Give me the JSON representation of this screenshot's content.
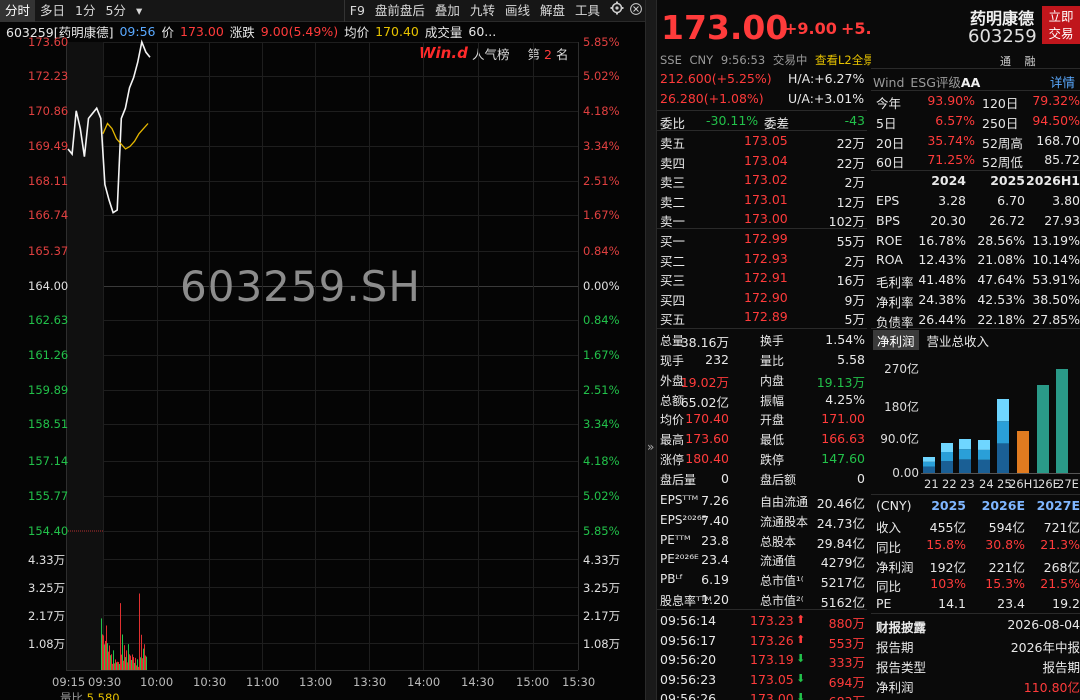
{
  "toolbar": {
    "items": [
      "分时",
      "多日",
      "1分",
      "5分",
      "▾",
      "F9",
      "盘前盘后",
      "叠加",
      "九转",
      "画线",
      "解盘",
      "工具"
    ],
    "gear_icon": "gear-icon",
    "close_icon": "close-icon"
  },
  "info": {
    "code": "603259[药明康德]",
    "time": "09:56",
    "price_label": "价",
    "price": "173.00",
    "change_label": "涨跌",
    "change": "9.00(5.49%)",
    "avg_label": "均价",
    "avg": "170.40",
    "vol_label": "成交量",
    "vol": "60..."
  },
  "chart": {
    "watermark": "603259.SH",
    "logo": "Win.d",
    "rank_label": "人气榜",
    "rank_prefix": "第",
    "rank_num": "2",
    "rank_suffix": "名",
    "left_prices": [
      "173.60",
      "172.23",
      "170.86",
      "169.49",
      "168.11",
      "166.74",
      "165.37",
      "164.00",
      "162.63",
      "161.26",
      "159.89",
      "158.51",
      "157.14",
      "155.77",
      "154.40"
    ],
    "right_pcts": [
      "5.85%",
      "5.02%",
      "4.18%",
      "3.34%",
      "2.51%",
      "1.67%",
      "0.84%",
      "0.00%",
      "0.84%",
      "1.67%",
      "2.51%",
      "3.34%",
      "4.18%",
      "5.02%",
      "5.85%"
    ],
    "vol_left": [
      "4.33万",
      "3.25万",
      "2.17万",
      "1.08万"
    ],
    "vol_right": [
      "4.33万",
      "3.25万",
      "2.17万",
      "1.08万"
    ],
    "x_labels": [
      "09:15",
      "09:30",
      "10:00",
      "10:30",
      "11:00",
      "13:00",
      "13:30",
      "14:00",
      "14:30",
      "15:00",
      "15:30"
    ],
    "bottom_label": "量比",
    "bottom_value": "5.580"
  },
  "header": {
    "price": "173.00",
    "change": "+9.00",
    "change_pct": "+5.49%",
    "name": "药明康德",
    "code": "603259",
    "trade_btn_line1": "立即",
    "trade_btn_line2": "交易",
    "exch": "SSE",
    "ccy": "CNY",
    "time": "9:56:53",
    "status": "交易中",
    "l2": "查看L2全景",
    "tong": "通",
    "rong": "融",
    "h_price": "212.600(+5.25%)",
    "h_ah": "H/A:+6.27%",
    "u_price": "26.280(+1.08%)",
    "u_ah": "U/A:+3.01%"
  },
  "orderbook": {
    "weibi_label": "委比",
    "weibi": "-30.11%",
    "weicha_label": "委差",
    "weicha": "-43",
    "asks": [
      {
        "label": "卖五",
        "price": "173.05",
        "vol": "22万"
      },
      {
        "label": "卖四",
        "price": "173.04",
        "vol": "22万"
      },
      {
        "label": "卖三",
        "price": "173.02",
        "vol": "2万"
      },
      {
        "label": "卖二",
        "price": "173.01",
        "vol": "12万"
      },
      {
        "label": "卖一",
        "price": "173.00",
        "vol": "102万"
      }
    ],
    "bids": [
      {
        "label": "买一",
        "price": "172.99",
        "vol": "55万"
      },
      {
        "label": "买二",
        "price": "172.93",
        "vol": "2万"
      },
      {
        "label": "买三",
        "price": "172.91",
        "vol": "16万"
      },
      {
        "label": "买四",
        "price": "172.90",
        "vol": "9万"
      },
      {
        "label": "买五",
        "price": "172.89",
        "vol": "5万"
      }
    ]
  },
  "stats": [
    {
      "l1": "总量",
      "v1": "38.16万",
      "c1": "white",
      "l2": "换手",
      "v2": "1.54%",
      "c2": "white"
    },
    {
      "l1": "现手",
      "v1": "232",
      "c1": "white",
      "l2": "量比",
      "v2": "5.58",
      "c2": "white"
    },
    {
      "l1": "外盘",
      "v1": "19.02万",
      "c1": "red",
      "l2": "内盘",
      "v2": "19.13万",
      "c2": "green"
    },
    {
      "l1": "总额",
      "v1": "65.02亿",
      "c1": "white",
      "l2": "振幅",
      "v2": "4.25%",
      "c2": "white"
    },
    {
      "l1": "均价",
      "v1": "170.40",
      "c1": "red",
      "l2": "开盘",
      "v2": "171.00",
      "c2": "red"
    },
    {
      "l1": "最高",
      "v1": "173.60",
      "c1": "red",
      "l2": "最低",
      "v2": "166.63",
      "c2": "red"
    },
    {
      "l1": "涨停",
      "v1": "180.40",
      "c1": "red",
      "l2": "跌停",
      "v2": "147.60",
      "c2": "green"
    },
    {
      "l1": "盘后量",
      "v1": "0",
      "c1": "white",
      "l2": "盘后额",
      "v2": "0",
      "c2": "white"
    },
    {
      "l1": "EPSᵀᵀᴹ",
      "v1": "7.26",
      "c1": "white",
      "l2": "自由流通",
      "v2": "20.46亿",
      "c2": "white"
    },
    {
      "l1": "EPS²⁰²⁶ᴱ",
      "v1": "7.40",
      "c1": "white",
      "l2": "流通股本",
      "v2": "24.73亿",
      "c2": "white"
    },
    {
      "l1": "PEᵀᵀᴹ",
      "v1": "23.8",
      "c1": "white",
      "l2": "总股本",
      "v2": "29.84亿",
      "c2": "white"
    },
    {
      "l1": "PE²⁰²⁶ᴱ",
      "v1": "23.4",
      "c1": "white",
      "l2": "流通值",
      "v2": "4279亿",
      "c2": "white"
    },
    {
      "l1": "PBᴸᶠ",
      "v1": "6.19",
      "c1": "white",
      "l2": "总市值¹⁽",
      "v2": "5217亿",
      "c2": "white"
    },
    {
      "l1": "股息率ᵀᵀᴹ",
      "v1": "1.20",
      "c1": "white",
      "l2": "总市值²⁽",
      "v2": "5162亿",
      "c2": "white"
    }
  ],
  "ticks": [
    {
      "time": "09:56:14",
      "price": "173.23",
      "dir": "up",
      "vol": "880万"
    },
    {
      "time": "09:56:17",
      "price": "173.26",
      "dir": "up",
      "vol": "553万"
    },
    {
      "time": "09:56:20",
      "price": "173.19",
      "dir": "down",
      "vol": "333万"
    },
    {
      "time": "09:56:23",
      "price": "173.05",
      "dir": "down",
      "vol": "694万"
    },
    {
      "time": "09:56:26",
      "price": "173.00",
      "dir": "down",
      "vol": "683万"
    }
  ],
  "right": {
    "tabs": [
      "Wind",
      "ESG评级",
      "AA"
    ],
    "detail": "详情",
    "perf": [
      {
        "l1": "今年",
        "v1": "93.90%",
        "l2": "120日",
        "v2": "79.32%"
      },
      {
        "l1": "5日",
        "v1": "6.57%",
        "l2": "250日",
        "v2": "94.50%"
      },
      {
        "l1": "20日",
        "v1": "35.74%",
        "l2": "52周高",
        "v2": "168.70"
      },
      {
        "l1": "60日",
        "v1": "71.25%",
        "l2": "52周低",
        "v2": "85.72"
      }
    ],
    "fin_head": [
      "2024",
      "2025",
      "2026H1"
    ],
    "fin": [
      {
        "l": "EPS",
        "a": "3.28",
        "b": "6.70",
        "c": "3.80"
      },
      {
        "l": "BPS",
        "a": "20.30",
        "b": "26.72",
        "c": "27.93"
      },
      {
        "l": "ROE",
        "a": "16.78%",
        "b": "28.56%",
        "c": "13.19%"
      },
      {
        "l": "ROA",
        "a": "12.43%",
        "b": "21.08%",
        "c": "10.14%"
      },
      {
        "l": "毛利率",
        "a": "41.48%",
        "b": "47.64%",
        "c": "53.91%"
      },
      {
        "l": "净利率",
        "a": "24.38%",
        "b": "42.53%",
        "c": "38.50%"
      },
      {
        "l": "负债率",
        "a": "26.44%",
        "b": "22.18%",
        "c": "27.85%"
      }
    ],
    "chart_tabs": [
      "净利润",
      "营业总收入"
    ],
    "chart_y": [
      "270亿",
      "180亿",
      "90.0亿",
      "0.00"
    ],
    "chart_x": [
      "21",
      "22",
      "23",
      "24",
      "25",
      "26H1",
      "26E",
      "27E"
    ],
    "fc_head": [
      "(CNY)",
      "2025",
      "2026E",
      "2027E"
    ],
    "fc": [
      {
        "l": "收入",
        "a": "455亿",
        "b": "594亿",
        "c": "721亿",
        "col": "white"
      },
      {
        "l": "同比",
        "a": "15.8%",
        "b": "30.8%",
        "c": "21.3%",
        "col": "red"
      },
      {
        "l": "净利润",
        "a": "192亿",
        "b": "221亿",
        "c": "268亿",
        "col": "white"
      },
      {
        "l": "同比",
        "a": "103%",
        "b": "15.3%",
        "c": "21.5%",
        "col": "red"
      },
      {
        "l": "PE",
        "a": "14.1",
        "b": "23.4",
        "c": "19.2",
        "col": "white"
      }
    ],
    "report_title": "财报披露",
    "report_date": "2026-08-04",
    "report_rows": [
      {
        "l": "报告期",
        "v": "2026年中报"
      },
      {
        "l": "报告类型",
        "v": "报告期"
      },
      {
        "l": "净利润",
        "v": "110.80亿"
      }
    ]
  },
  "chart_data": {
    "type": "line",
    "x_range": [
      "09:30",
      "15:00"
    ],
    "ylim": [
      154.4,
      173.6
    ],
    "base": 164.0,
    "price": [
      169.4,
      169.2,
      170.9,
      170.2,
      169.1,
      170.6,
      170.8,
      171.0,
      170.6,
      168.0,
      167.4,
      166.9,
      167.0,
      170.6,
      171.0,
      171.8,
      172.2,
      172.8,
      173.6,
      173.2,
      173.0
    ],
    "avg": [
      170.0,
      170.4,
      170.2,
      169.8,
      169.6,
      169.4,
      169.5,
      169.7,
      170.0,
      170.2,
      170.4
    ],
    "volume": [
      43300,
      12000,
      21000,
      9000,
      14000,
      17000,
      11000,
      8000,
      15000,
      13000,
      9000,
      7000,
      11000,
      8000,
      6000,
      7000,
      5000,
      6000,
      4000
    ]
  }
}
